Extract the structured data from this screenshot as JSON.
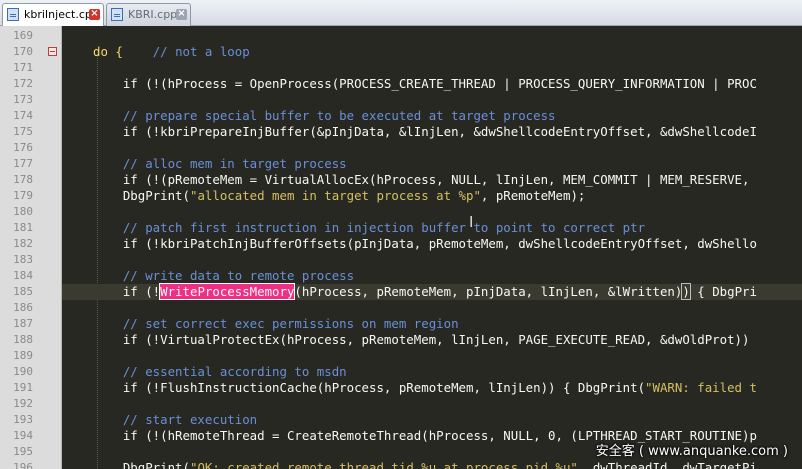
{
  "tabs": [
    {
      "label": "kbriInject.cpp",
      "active": true
    },
    {
      "label": "KBRI.cpp",
      "active": false
    }
  ],
  "colors": {
    "background": "#272822",
    "comment": "#6a8fd8",
    "keyword": "#f5d76e",
    "string": "#d7bf63",
    "selection_highlight": "#ef2f86",
    "gutter": "#dcdcdc"
  },
  "lines": [
    {
      "no": "169",
      "tokens": []
    },
    {
      "no": "170",
      "fold": true,
      "tokens": [
        {
          "t": "do {    ",
          "c": "kw"
        },
        {
          "t": "// not a loop",
          "c": "cm"
        }
      ]
    },
    {
      "no": "171",
      "tokens": []
    },
    {
      "no": "172",
      "tokens": [
        {
          "t": "    if (!(hProcess = OpenProcess(PROCESS_CREATE_THREAD | PROCESS_QUERY_INFORMATION | PROC",
          "c": ""
        }
      ]
    },
    {
      "no": "173",
      "tokens": []
    },
    {
      "no": "174",
      "tokens": [
        {
          "t": "    // prepare special buffer to be executed at target process",
          "c": "cm"
        }
      ]
    },
    {
      "no": "175",
      "tokens": [
        {
          "t": "    if (!kbriPrepareInjBuffer(&pInjData, &lInjLen, &dwShellcodeEntryOffset, &dwShellcodeI",
          "c": ""
        }
      ]
    },
    {
      "no": "176",
      "tokens": []
    },
    {
      "no": "177",
      "tokens": [
        {
          "t": "    // alloc mem in target process",
          "c": "cm"
        }
      ]
    },
    {
      "no": "178",
      "tokens": [
        {
          "t": "    if (!(pRemoteMem = VirtualAllocEx(hProcess, NULL, lInjLen, MEM_COMMIT | MEM_RESERVE, ",
          "c": ""
        }
      ]
    },
    {
      "no": "179",
      "tokens": [
        {
          "t": "    DbgPrint(",
          "c": ""
        },
        {
          "t": "\"allocated mem in target process at %p\"",
          "c": "st"
        },
        {
          "t": ", pRemoteMem);",
          "c": ""
        }
      ]
    },
    {
      "no": "180",
      "tokens": []
    },
    {
      "no": "181",
      "tokens": [
        {
          "t": "    // patch first instruction in injection buffer to point to correct ptr",
          "c": "cm"
        }
      ]
    },
    {
      "no": "182",
      "tokens": [
        {
          "t": "    if (!kbriPatchInjBufferOffsets(pInjData, pRemoteMem, dwShellcodeEntryOffset, dwShello",
          "c": ""
        }
      ]
    },
    {
      "no": "183",
      "tokens": []
    },
    {
      "no": "184",
      "tokens": [
        {
          "t": "    // write data to remote process",
          "c": "cm"
        }
      ]
    },
    {
      "no": "185",
      "current": true,
      "tokens": [
        {
          "t": "    if (!",
          "c": ""
        },
        {
          "t": "WriteProcessMemory",
          "c": "hl"
        },
        {
          "t": "(hProcess, pRemoteMem, pInjData, lInjLen, &lWritten)",
          "c": ""
        },
        {
          "t": ")",
          "c": "brm"
        },
        {
          "t": " { DbgPri",
          "c": ""
        }
      ]
    },
    {
      "no": "186",
      "tokens": []
    },
    {
      "no": "187",
      "tokens": [
        {
          "t": "    // set correct exec permissions on mem region",
          "c": "cm"
        }
      ]
    },
    {
      "no": "188",
      "tokens": [
        {
          "t": "    if (!VirtualProtectEx(hProcess, pRemoteMem, lInjLen, PAGE_EXECUTE_READ, &dwOldProt))",
          "c": ""
        }
      ]
    },
    {
      "no": "189",
      "tokens": []
    },
    {
      "no": "190",
      "tokens": [
        {
          "t": "    // essential according to msdn",
          "c": "cm"
        }
      ]
    },
    {
      "no": "191",
      "tokens": [
        {
          "t": "    if (!FlushInstructionCache(hProcess, pRemoteMem, lInjLen)) { DbgPrint(",
          "c": ""
        },
        {
          "t": "\"WARN: failed t",
          "c": "st"
        }
      ]
    },
    {
      "no": "192",
      "tokens": []
    },
    {
      "no": "193",
      "tokens": [
        {
          "t": "    // start execution",
          "c": "cm"
        }
      ]
    },
    {
      "no": "194",
      "tokens": [
        {
          "t": "    if (!(hRemoteThread = CreateRemoteThread(hProcess, NULL, 0, (LPTHREAD_START_ROUTINE)p",
          "c": ""
        }
      ]
    },
    {
      "no": "195",
      "tokens": []
    },
    {
      "no": "196",
      "tokens": [
        {
          "t": "    DbgPrint(",
          "c": ""
        },
        {
          "t": "\"OK: created remote thread tid %u at process pid %u\"",
          "c": "st"
        },
        {
          "t": ", dwThreadId, dwTargetPi",
          "c": ""
        }
      ]
    }
  ],
  "watermark": "安全客 ( www.anquanke.com )"
}
